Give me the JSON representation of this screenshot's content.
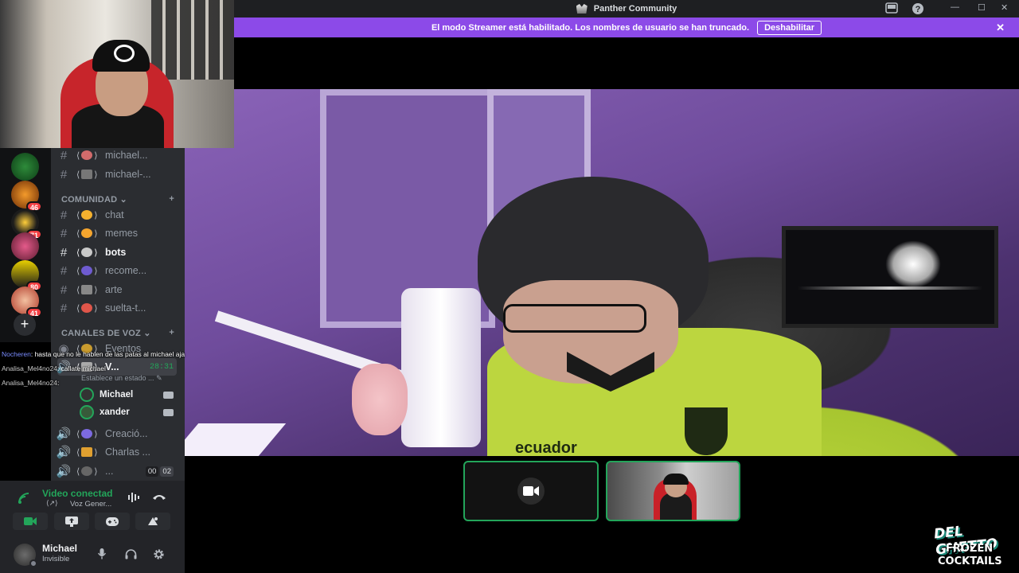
{
  "window": {
    "title": "Panther Community",
    "controls": {
      "minimize": "—",
      "maximize": "☐",
      "close": "✕"
    }
  },
  "banner": {
    "message": "El modo Streamer está habilitado. Los nombres de usuario se han truncado.",
    "button_label": "Deshabilitar",
    "close_label": "✕"
  },
  "stage": {
    "jersey_text": "ecuador"
  },
  "servers": [
    {
      "badge": ""
    },
    {
      "badge": "46"
    },
    {
      "badge": "71"
    },
    {
      "badge": ""
    },
    {
      "badge": "80"
    },
    {
      "badge": "41"
    }
  ],
  "channels": {
    "top": [
      {
        "name": "michael..."
      },
      {
        "name": "michael-..."
      }
    ],
    "categories": {
      "comunidad": "COMUNIDAD",
      "voz": "CANALES DE VOZ"
    },
    "comunidad": [
      {
        "name": "chat"
      },
      {
        "name": "memes"
      },
      {
        "name": "bots"
      },
      {
        "name": "recome..."
      },
      {
        "name": "arte"
      },
      {
        "name": "suelta-t..."
      }
    ],
    "voz": {
      "eventos": "Eventos",
      "current_channel": "V...",
      "timer": "28:31",
      "status_hint": "Establece un estado ...",
      "members": [
        {
          "name": "Michael"
        },
        {
          "name": "xander"
        }
      ],
      "others": [
        {
          "name": "Creació..."
        },
        {
          "name": "Charlas ..."
        },
        {
          "name": "..."
        }
      ],
      "counter_a": "00",
      "counter_b": "02"
    }
  },
  "chat_overlay": [
    {
      "user": "Nocheren",
      "text": ": hasta que no le hablen de las patas al michael aja"
    },
    {
      "user": "Analisa_Mel4no24",
      "text": ": callate michael"
    },
    {
      "user": "Analisa_Mel4no24",
      "text": ":"
    }
  ],
  "voice_panel": {
    "status": "Video conectad",
    "channel": "Voz Gener...",
    "user_name": "Michael",
    "user_status": "Invisible"
  },
  "brand": {
    "line1": "DEL GHETTO",
    "line2": "FROZEN",
    "line3": "COCKTAILS"
  },
  "colors": {
    "accent_purple": "#8c4ae8",
    "connected_green": "#23a55a",
    "badge_red": "#f23f43"
  }
}
